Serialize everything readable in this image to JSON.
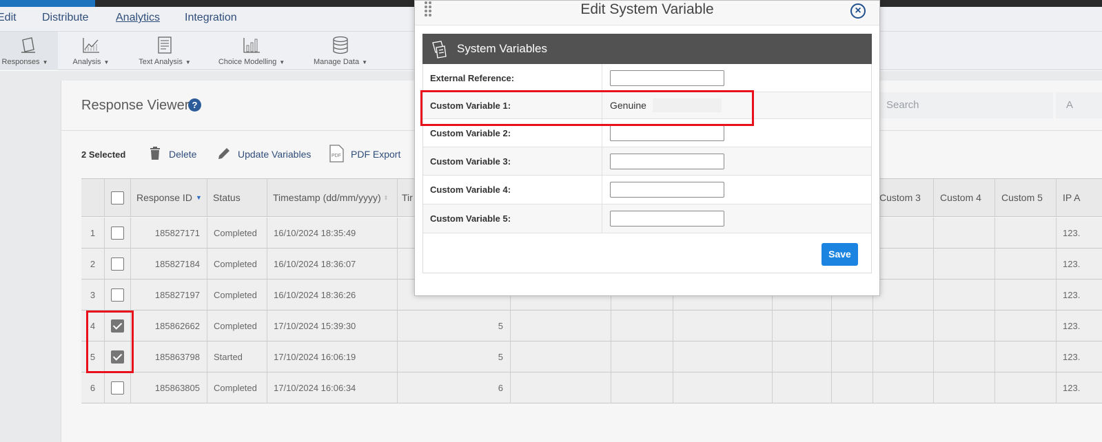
{
  "menu": {
    "items": [
      {
        "label": "Edit"
      },
      {
        "label": "Distribute"
      },
      {
        "label": "Analytics"
      },
      {
        "label": "Integration"
      }
    ]
  },
  "toolbar": {
    "items": [
      {
        "label": "Responses",
        "icon": "responses-icon"
      },
      {
        "label": "Analysis",
        "icon": "analysis-icon"
      },
      {
        "label": "Text Analysis",
        "icon": "text-analysis-icon"
      },
      {
        "label": "Choice Modelling",
        "icon": "choice-modelling-icon"
      },
      {
        "label": "Manage Data",
        "icon": "database-icon"
      }
    ]
  },
  "response_viewer": {
    "title": "Response Viewer",
    "search_placeholder": "Search",
    "search_right_fragment": "A",
    "selected_count": "2 Selected",
    "actions": {
      "delete": "Delete",
      "update_variables": "Update Variables",
      "pdf_export": "PDF Export"
    }
  },
  "table": {
    "headers": {
      "response_id": "Response ID",
      "status": "Status",
      "timestamp": "Timestamp (dd/mm/yyyy)",
      "time_fragment": "Tir",
      "custom3": "Custom 3",
      "custom4": "Custom 4",
      "custom5": "Custom 5",
      "ip_fragment": "IP A"
    },
    "rows": [
      {
        "n": "1",
        "id": "185827171",
        "status": "Completed",
        "ts": "16/10/2024 18:35:49",
        "mid": "",
        "ip": "123.",
        "checked": false
      },
      {
        "n": "2",
        "id": "185827184",
        "status": "Completed",
        "ts": "16/10/2024 18:36:07",
        "mid": "",
        "ip": "123.",
        "checked": false
      },
      {
        "n": "3",
        "id": "185827197",
        "status": "Completed",
        "ts": "16/10/2024 18:36:26",
        "mid": "",
        "ip": "123.",
        "checked": false
      },
      {
        "n": "4",
        "id": "185862662",
        "status": "Completed",
        "ts": "17/10/2024 15:39:30",
        "mid": "5",
        "ip": "123.",
        "checked": true
      },
      {
        "n": "5",
        "id": "185863798",
        "status": "Started",
        "ts": "17/10/2024 16:06:19",
        "mid": "5",
        "ip": "123.",
        "checked": true
      },
      {
        "n": "6",
        "id": "185863805",
        "status": "Completed",
        "ts": "17/10/2024 16:06:34",
        "mid": "6",
        "ip": "123.",
        "checked": false
      }
    ]
  },
  "modal": {
    "title": "Edit System Variable",
    "section_title": "System Variables",
    "fields": [
      {
        "label": "External Reference:",
        "value": ""
      },
      {
        "label": "Custom Variable 1:",
        "value": "Genuine"
      },
      {
        "label": "Custom Variable 2:",
        "value": ""
      },
      {
        "label": "Custom Variable 3:",
        "value": ""
      },
      {
        "label": "Custom Variable 4:",
        "value": ""
      },
      {
        "label": "Custom Variable 5:",
        "value": ""
      }
    ],
    "save_label": "Save"
  },
  "colors": {
    "accent": "#1a84e0",
    "link": "#2f4d7a",
    "highlight": "#e8101a",
    "section_header": "#525252"
  }
}
